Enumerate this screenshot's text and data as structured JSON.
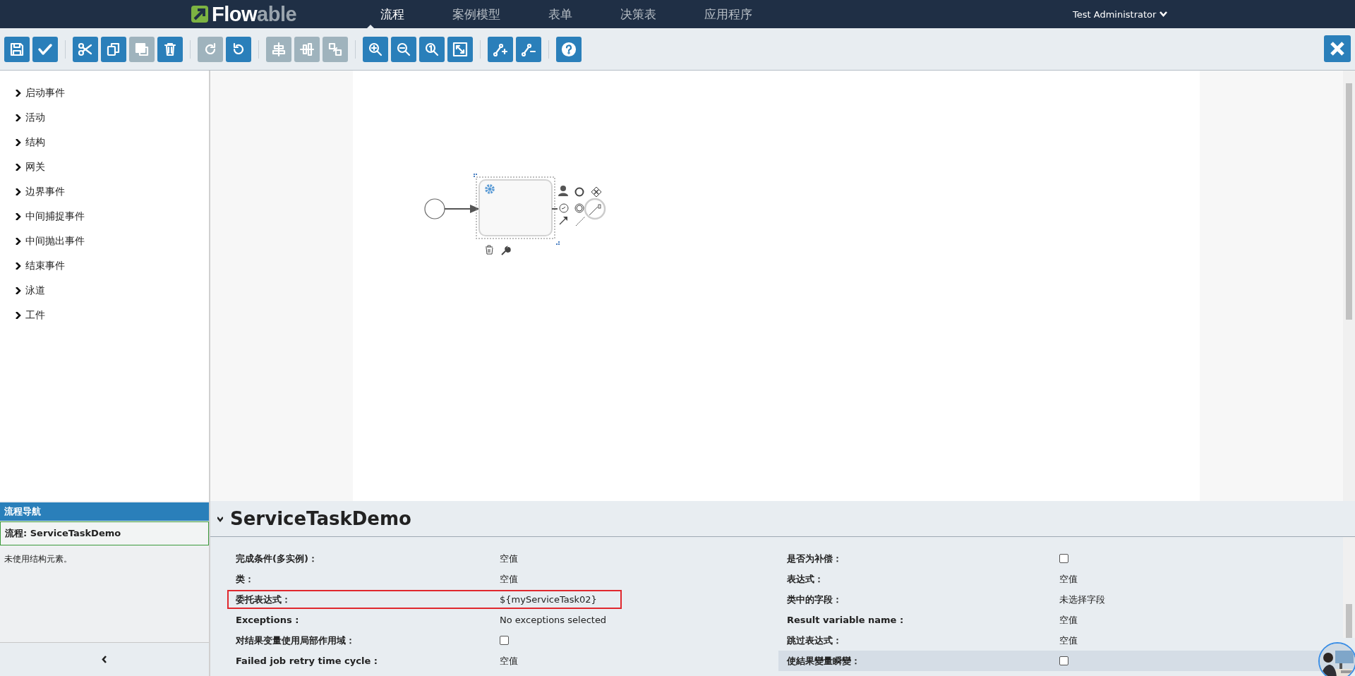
{
  "logo": {
    "part1": "Flow",
    "part2": "able"
  },
  "nav": [
    {
      "label": "流程",
      "selected": true
    },
    {
      "label": "案例模型",
      "selected": false
    },
    {
      "label": "表单",
      "selected": false
    },
    {
      "label": "决策表",
      "selected": false
    },
    {
      "label": "应用程序",
      "selected": false
    }
  ],
  "user": {
    "name": "Test Administrator"
  },
  "toolbar_groups": [
    [
      {
        "disabled": false
      },
      {
        "disabled": false
      }
    ],
    [
      {
        "disabled": false
      },
      {
        "disabled": false
      },
      {
        "disabled": true
      },
      {
        "disabled": false
      }
    ],
    [
      {
        "disabled": true
      },
      {
        "disabled": false
      }
    ],
    [
      {
        "disabled": true
      },
      {
        "disabled": true
      },
      {
        "disabled": true
      }
    ],
    [
      {
        "disabled": false
      },
      {
        "disabled": false
      },
      {
        "disabled": false
      },
      {
        "disabled": false
      }
    ],
    [
      {
        "disabled": false
      },
      {
        "disabled": false
      }
    ],
    [
      {
        "disabled": false
      }
    ]
  ],
  "palette": [
    {
      "label": "启动事件",
      "expanded": false
    },
    {
      "label": "活动",
      "expanded": false
    },
    {
      "label": "结构",
      "expanded": false
    },
    {
      "label": "网关",
      "expanded": false
    },
    {
      "label": "边界事件",
      "expanded": false
    },
    {
      "label": "中间捕捉事件",
      "expanded": false
    },
    {
      "label": "中间抛出事件",
      "expanded": false
    },
    {
      "label": "结束事件",
      "expanded": false
    },
    {
      "label": "泳道",
      "expanded": false
    },
    {
      "label": "工件",
      "expanded": false
    }
  ],
  "navigator": {
    "title": "流程导航",
    "item": "流程: ServiceTaskDemo",
    "note": "未使用结构元素。"
  },
  "properties": {
    "title": "ServiceTaskDemo",
    "expanded": true,
    "left": [
      {
        "label": "完成条件(多实例)：",
        "kind": "text",
        "value": "空值",
        "outlined": false,
        "highlighted": false
      },
      {
        "label": "类：",
        "kind": "text",
        "value": "空值",
        "outlined": false,
        "highlighted": false
      },
      {
        "label": "委托表达式：",
        "kind": "text",
        "value": "${myServiceTask02}",
        "outlined": true,
        "highlighted": false
      },
      {
        "label": "Exceptions :",
        "kind": "text",
        "value": "No exceptions selected",
        "outlined": false,
        "highlighted": false
      },
      {
        "label": "对结果变量使用局部作用域：",
        "kind": "checkbox",
        "checked": false,
        "outlined": false,
        "highlighted": false
      },
      {
        "label": "Failed job retry time cycle :",
        "kind": "text",
        "value": "空值",
        "outlined": false,
        "highlighted": false
      }
    ],
    "right": [
      {
        "label": "是否为补偿：",
        "kind": "checkbox",
        "checked": false,
        "outlined": false,
        "highlighted": false
      },
      {
        "label": "表达式：",
        "kind": "text",
        "value": "空值",
        "outlined": false,
        "highlighted": false
      },
      {
        "label": "类中的字段：",
        "kind": "text",
        "value": "未选择字段",
        "outlined": false,
        "highlighted": false
      },
      {
        "label": "Result variable name :",
        "kind": "text",
        "value": "空值",
        "outlined": false,
        "highlighted": false
      },
      {
        "label": "跳过表达式：",
        "kind": "text",
        "value": "空值",
        "outlined": false,
        "highlighted": false
      },
      {
        "label": "使結果變量瞬變：",
        "kind": "checkbox",
        "checked": false,
        "outlined": false,
        "highlighted": true
      }
    ]
  }
}
